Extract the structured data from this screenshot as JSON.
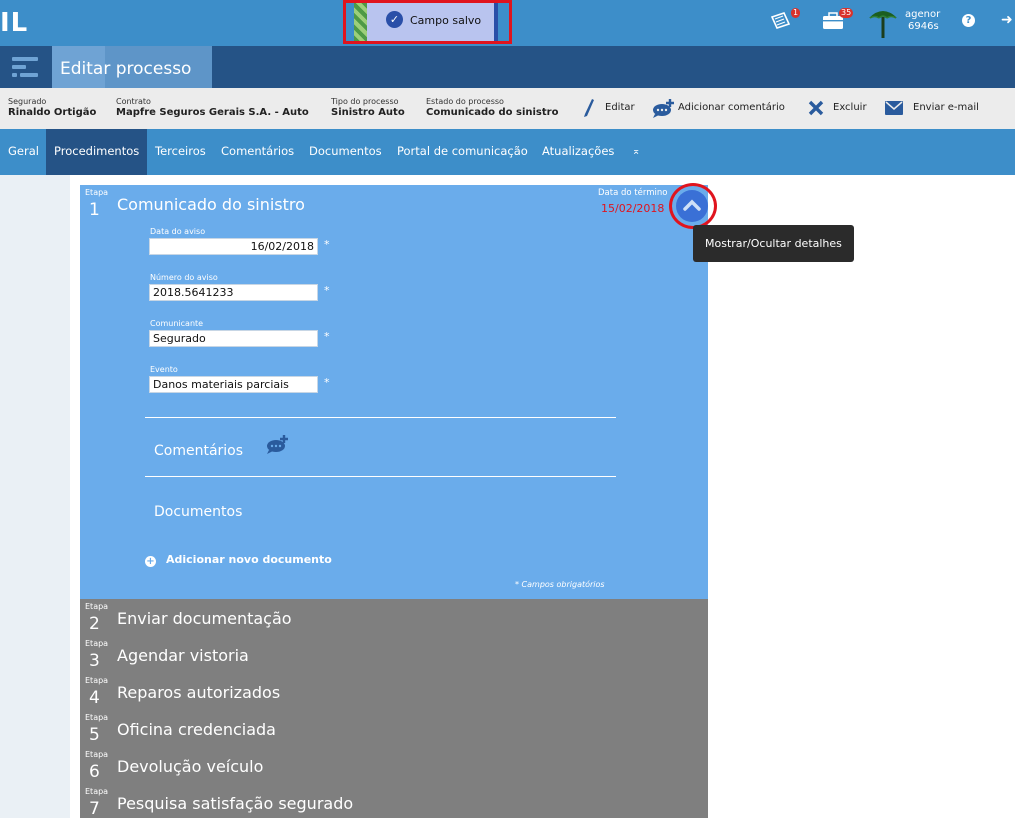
{
  "header": {
    "logo": "IL",
    "toast": "Campo salvo",
    "notifications_count": "1",
    "tasks_count": "35",
    "user_name": "agenor",
    "user_id": "6946s"
  },
  "titlebar": {
    "title": "Editar processo"
  },
  "info": {
    "fields": [
      {
        "label": "Segurado",
        "value": "Rinaldo Ortigão"
      },
      {
        "label": "Contrato",
        "value": "Mapfre Seguros Gerais S.A. - Auto"
      },
      {
        "label": "Tipo do processo",
        "value": "Sinistro Auto"
      },
      {
        "label": "Estado do processo",
        "value": "Comunicado do sinistro"
      }
    ],
    "actions": [
      "Editar",
      "Adicionar comentário",
      "Excluir",
      "Enviar e-mail"
    ]
  },
  "tabs": [
    "Geral",
    "Procedimentos",
    "Terceiros",
    "Comentários",
    "Documentos",
    "Portal de comunicação",
    "Atualizações"
  ],
  "stage1": {
    "etapa_label": "Etapa",
    "number": "1",
    "title": "Comunicado do sinistro",
    "term_label": "Data do término",
    "term_value": "15/02/2018",
    "fields": [
      {
        "label": "Data do aviso",
        "value": "16/02/2018"
      },
      {
        "label": "Número do aviso",
        "value": "2018.5641233"
      },
      {
        "label": "Comunicante",
        "value": "Segurado"
      },
      {
        "label": "Evento",
        "value": "Danos materiais parciais"
      }
    ],
    "required_mark": "*",
    "comments_title": "Comentários",
    "documents_title": "Documentos",
    "add_document": "Adicionar novo documento",
    "required_note": "* Campos obrigatórios"
  },
  "tooltip": "Mostrar/Ocultar detalhes",
  "stages": [
    {
      "label": "Etapa",
      "number": "2",
      "title": "Enviar documentação"
    },
    {
      "label": "Etapa",
      "number": "3",
      "title": "Agendar vistoria"
    },
    {
      "label": "Etapa",
      "number": "4",
      "title": "Reparos autorizados"
    },
    {
      "label": "Etapa",
      "number": "5",
      "title": "Oficina credenciada"
    },
    {
      "label": "Etapa",
      "number": "6",
      "title": "Devolução veículo"
    },
    {
      "label": "Etapa",
      "number": "7",
      "title": "Pesquisa satisfação segurado"
    }
  ],
  "colors": {
    "topbar": "#3d8ec9",
    "titlebar": "#255386",
    "stage_active": "#6aaceb",
    "stage_inactive": "#7f7f7f",
    "highlight": "#e0141e"
  }
}
